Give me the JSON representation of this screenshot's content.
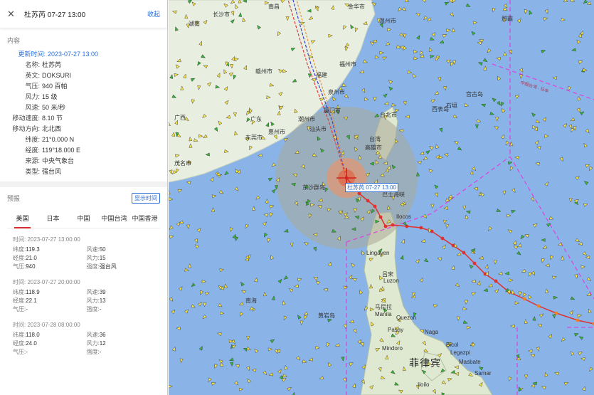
{
  "header": {
    "title": "杜苏芮 07-27 13:00",
    "collapse_label": "收起",
    "close_icon": "close-icon"
  },
  "content_section_title": "内容",
  "info": [
    {
      "k": "更新时间:",
      "v": "2023-07-27 13:00"
    },
    {
      "k": "名称:",
      "v": "杜苏芮"
    },
    {
      "k": "英文:",
      "v": "DOKSURI"
    },
    {
      "k": "气压:",
      "v": "940 百帕"
    },
    {
      "k": "风力:",
      "v": "15 级"
    },
    {
      "k": "风速:",
      "v": "50 米/秒"
    },
    {
      "k": "移动速度:",
      "v": "8.10 节"
    },
    {
      "k": "移动方向:",
      "v": "北北西"
    },
    {
      "k": "纬度:",
      "v": "21°0.000 N"
    },
    {
      "k": "经度:",
      "v": "119°18.000 E"
    },
    {
      "k": "来源:",
      "v": "中央气象台"
    },
    {
      "k": "类型:",
      "v": "强台风"
    }
  ],
  "forecast": {
    "label": "预报",
    "show_time_label": "显示时间",
    "tabs": [
      "美国",
      "日本",
      "中国",
      "中国台湾",
      "中国香港"
    ],
    "active_tab": 0,
    "items": [
      {
        "time": "时间: 2023-07-27 13:00:00",
        "lat_k": "纬度:",
        "lat": "119.3",
        "speed_k": "风速:",
        "speed": "50",
        "lon_k": "经度:",
        "lon": "21.0",
        "force_k": "风力:",
        "force": "15",
        "pres_k": "气压:",
        "pres": "940",
        "type_k": "强度:",
        "type": "强台风"
      },
      {
        "time": "时间: 2023-07-27 20:00:00",
        "lat_k": "纬度:",
        "lat": "118.9",
        "speed_k": "风速:",
        "speed": "39",
        "lon_k": "经度:",
        "lon": "22.1",
        "force_k": "风力:",
        "force": "13",
        "pres_k": "气压:",
        "pres": "-",
        "type_k": "强度:",
        "type": "-"
      },
      {
        "time": "时间: 2023-07-28 08:00:00",
        "lat_k": "纬度:",
        "lat": "118.0",
        "speed_k": "风速:",
        "speed": "36",
        "lon_k": "经度:",
        "lon": "24.0",
        "force_k": "风力:",
        "force": "12",
        "pres_k": "气压:",
        "pres": "-",
        "type_k": "强度:",
        "type": "-"
      }
    ]
  },
  "map": {
    "typhoon_label": "杜苏芮  07-27 13:00",
    "cities": [
      "南昌",
      "金华市",
      "温州市",
      "长沙市",
      "赣州市",
      "福建",
      "福州市",
      "湖南",
      "广西",
      "广东",
      "泉州市",
      "潮州市",
      "厦门市",
      "汕头市",
      "东莞市",
      "惠州市",
      "茂名市",
      "台北市",
      "台湾",
      "高雄市",
      "东沙群岛",
      "巴士海峡",
      "吕宋",
      "Luzon",
      "马尼拉",
      "Manila",
      "南海",
      "黄岩岛",
      "菲律宾",
      "Lingayen",
      "Pasay",
      "Quezon",
      "Ilocos",
      "Iloilo",
      "Bicol",
      "Legazpi",
      "Naga",
      "Masbate",
      "Samar",
      "Mindoro",
      "那霸",
      "石垣",
      "宫古岛",
      "西表岛"
    ],
    "china_label": "中国台湾 - 日本",
    "colors": {
      "sea": "#8ab4e8",
      "land": "#e8eee0",
      "track": "#e03030",
      "forecast": "#f08020",
      "ship_yellow": "#f4e04a",
      "ship_green": "#36b436"
    }
  }
}
